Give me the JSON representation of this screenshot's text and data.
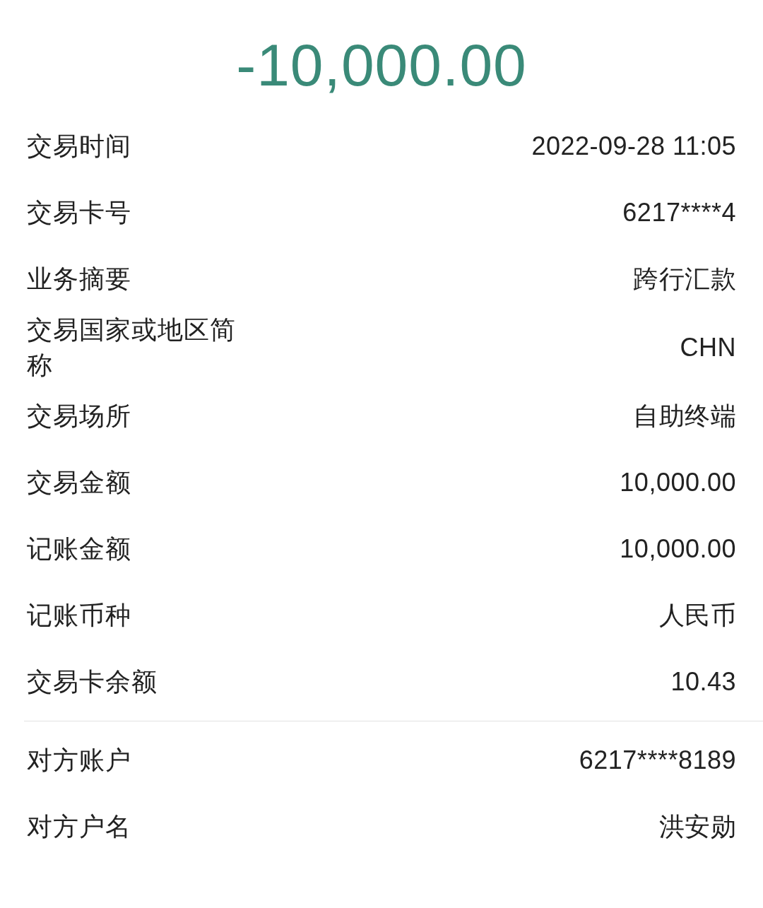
{
  "amount": "-10,000.00",
  "sections": [
    {
      "rows": [
        {
          "label": "交易时间",
          "value": "2022-09-28 11:05"
        },
        {
          "label": "交易卡号",
          "value": "6217****4"
        },
        {
          "label": "业务摘要",
          "value": "跨行汇款"
        },
        {
          "label": "交易国家或地区简称",
          "value": "CHN"
        },
        {
          "label": "交易场所",
          "value": "自助终端"
        },
        {
          "label": "交易金额",
          "value": "10,000.00"
        },
        {
          "label": "记账金额",
          "value": "10,000.00"
        },
        {
          "label": "记账币种",
          "value": "人民币"
        },
        {
          "label": "交易卡余额",
          "value": "10.43"
        }
      ]
    },
    {
      "rows": [
        {
          "label": "对方账户",
          "value": "6217****8189"
        },
        {
          "label": "对方户名",
          "value": "洪安勋"
        }
      ]
    }
  ]
}
